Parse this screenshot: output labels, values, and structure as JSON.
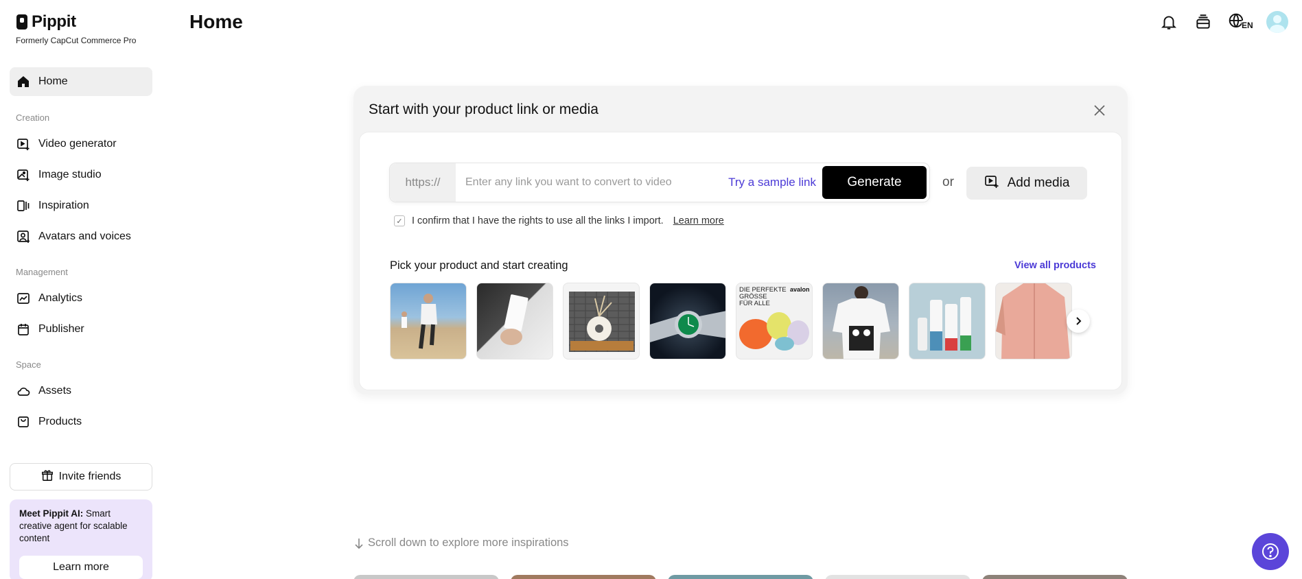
{
  "brand": {
    "name": "Pippit",
    "subtitle": "Formerly CapCut Commerce Pro"
  },
  "sidebar": {
    "home": "Home",
    "sections": [
      {
        "label": "Creation",
        "items": [
          "Video generator",
          "Image studio",
          "Inspiration",
          "Avatars and voices"
        ]
      },
      {
        "label": "Management",
        "items": [
          "Analytics",
          "Publisher"
        ]
      },
      {
        "label": "Space",
        "items": [
          "Assets",
          "Products"
        ]
      }
    ],
    "invite_label": "Invite friends",
    "promo": {
      "bold": "Meet Pippit AI:",
      "text": " Smart creative agent for scalable content",
      "button": "Learn more"
    }
  },
  "header": {
    "title": "Home",
    "language": "EN"
  },
  "card": {
    "title": "Start with your product link or media",
    "prefix": "https://",
    "placeholder": "Enter any link you want to convert to video",
    "sample_link": "Try a sample link",
    "generate": "Generate",
    "or": "or",
    "add_media": "Add media",
    "confirm_text": "I confirm that I have the rights to use all the links I import.",
    "confirm_link": "Learn more",
    "pick_title": "Pick your product and start creating",
    "view_all": "View all products",
    "thumb_overlay": {
      "line1": "DIE PERFEKTE",
      "line2": "GRÖSSE",
      "line3": "FÜR ALLE",
      "brand": "avalon"
    }
  },
  "scroll_hint": "Scroll down to explore more inspirations",
  "colors": {
    "accent": "#4b3ad6",
    "help_button": "#5b45d9",
    "promo_bg": "#ece4fb"
  }
}
